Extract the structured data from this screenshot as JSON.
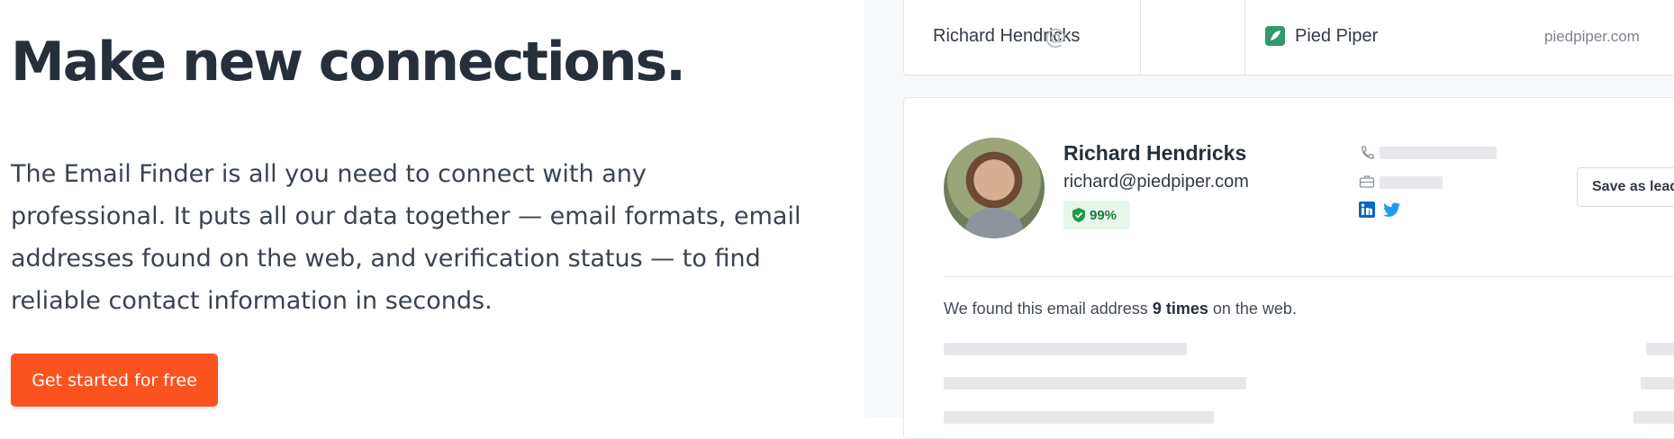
{
  "hero": {
    "headline": "Make new connections.",
    "description": "The Email Finder is all you need to connect with any professional. It puts all our data together — email formats, email addresses found on the web, and verification status — to find reliable contact information in seconds.",
    "cta_label": "Get started for free"
  },
  "search": {
    "full_name": "Richard Hendricks",
    "at_symbol": "@",
    "company_name": "Pied Piper",
    "domain": "piedpiper.com"
  },
  "result": {
    "name": "Richard Hendricks",
    "email": "richard@piedpiper.com",
    "confidence": "99%",
    "save_label": "Save as lead",
    "found_prefix": "We found this email address",
    "found_count": "9 times",
    "found_suffix": "on the web."
  },
  "icons": [
    "at-icon",
    "pied-piper-logo",
    "shield-check-icon",
    "phone-icon",
    "briefcase-icon",
    "linkedin-icon",
    "twitter-icon"
  ],
  "colors": {
    "accent": "#fa5320",
    "verified_bg": "#e7f6ea",
    "verified_text": "#1e7a3a",
    "linkedin": "#0a66c2",
    "twitter": "#1d9bf0",
    "pied_piper": "#2e9a68"
  }
}
